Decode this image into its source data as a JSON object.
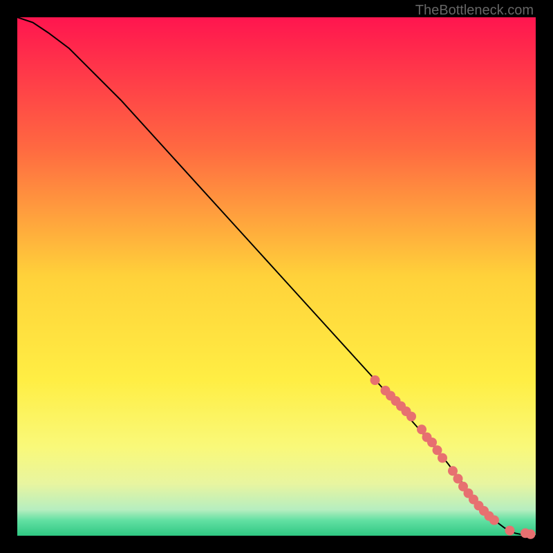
{
  "watermark": "TheBottleneck.com",
  "chart_data": {
    "type": "line",
    "title": "",
    "xlabel": "",
    "ylabel": "",
    "xlim": [
      0,
      100
    ],
    "ylim": [
      0,
      100
    ],
    "gradient_stops": [
      {
        "pct": 0,
        "color": "#ff154f"
      },
      {
        "pct": 25,
        "color": "#ff6841"
      },
      {
        "pct": 50,
        "color": "#ffd23a"
      },
      {
        "pct": 70,
        "color": "#ffee44"
      },
      {
        "pct": 83,
        "color": "#f9f97a"
      },
      {
        "pct": 90,
        "color": "#e8f5a0"
      },
      {
        "pct": 95,
        "color": "#b6eec0"
      },
      {
        "pct": 97,
        "color": "#63e0a3"
      },
      {
        "pct": 100,
        "color": "#2fc883"
      }
    ],
    "series": [
      {
        "name": "bottleneck-curve",
        "x": [
          0,
          3,
          6,
          10,
          15,
          20,
          30,
          40,
          50,
          60,
          70,
          78,
          83,
          86,
          88,
          90,
          92,
          94,
          96,
          98,
          100
        ],
        "y": [
          100,
          99,
          97,
          94,
          89,
          84,
          73,
          62,
          51,
          40,
          29,
          20,
          14,
          10,
          7,
          5,
          3,
          1.5,
          0.5,
          0.1,
          0
        ]
      }
    ],
    "highlight_points": {
      "name": "highlight-dots",
      "x": [
        69,
        71,
        72,
        73,
        74,
        75,
        76,
        78,
        79,
        80,
        81,
        82,
        84,
        85,
        86,
        87,
        88,
        89,
        90,
        91,
        92,
        95,
        98,
        99
      ],
      "y": [
        30,
        28,
        27,
        26,
        25,
        24,
        23,
        20.5,
        19,
        18,
        16.5,
        15,
        12.5,
        11,
        9.5,
        8.2,
        7,
        5.8,
        4.8,
        3.8,
        3,
        1,
        0.5,
        0.3
      ]
    },
    "dot_color": "#e77070",
    "curve_color": "#000000"
  }
}
